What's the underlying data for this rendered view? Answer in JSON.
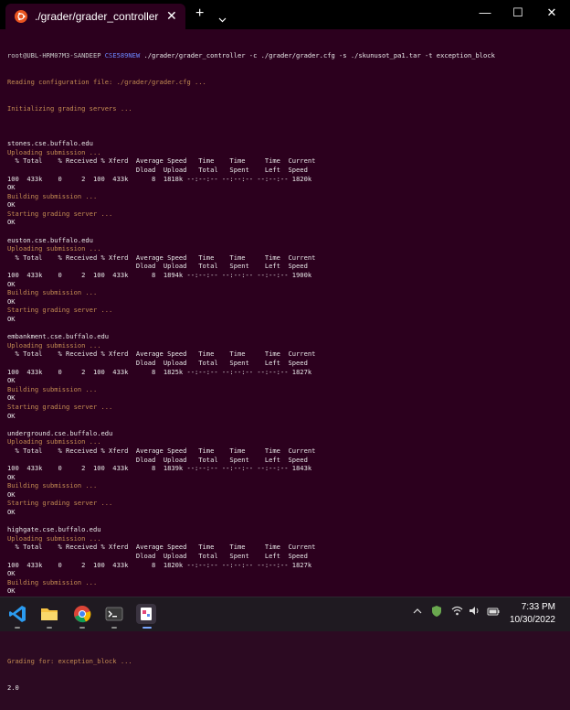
{
  "tab": {
    "title": "./grader/grader_controller",
    "close": "✕",
    "new_tab": "+"
  },
  "window_controls": {
    "minimize": "—",
    "maximize": "☐",
    "close": "✕"
  },
  "prompt": {
    "user": "root@UBL-HRM07M3-SANDEEP",
    "path": "CSE589NEW",
    "command": " ./grader/grader_controller -c ./grader/grader.cfg -s ./skunusot_pa1.tar -t exception_block"
  },
  "header_lines": [
    "Reading configuration file: ./grader/grader.cfg ...",
    "Initializing grading servers ..."
  ],
  "servers": [
    {
      "host": "stones.cse.buffalo.edu",
      "xfer": "100  433k    0     2  100  433k      8  1818k --:--:-- --:--:-- --:--:-- 1820k"
    },
    {
      "host": "euston.cse.buffalo.edu",
      "xfer": "100  433k    0     2  100  433k      8  1894k --:--:-- --:--:-- --:--:-- 1900k"
    },
    {
      "host": "embankment.cse.buffalo.edu",
      "xfer": "100  433k    0     2  100  433k      8  1825k --:--:-- --:--:-- --:--:-- 1827k"
    },
    {
      "host": "underground.cse.buffalo.edu",
      "xfer": "100  433k    0     2  100  433k      8  1839k --:--:-- --:--:-- --:--:-- 1843k"
    },
    {
      "host": "highgate.cse.buffalo.edu",
      "xfer": "100  433k    0     2  100  433k      8  1820k --:--:-- --:--:-- --:--:-- 1827k"
    }
  ],
  "labels": {
    "uploading": "Uploading submission ...",
    "col_head1": "  % Total    % Received % Xferd  Average Speed   Time    Time     Time  Current",
    "col_head2": "                                 Dload  Upload   Total   Spent    Left  Speed",
    "ok": "OK",
    "building": "Building submission ...",
    "starting": "Starting grading server ..."
  },
  "footer": {
    "grading": "Grading for: exception_block ...",
    "score": "2.0"
  },
  "taskbar": {
    "time": "7:33 PM",
    "date": "10/30/2022"
  },
  "colors": {
    "terminal_bg": "#2c001e",
    "info": "#c38b52",
    "path": "#6b86ff",
    "ubuntu": "#e95420"
  }
}
